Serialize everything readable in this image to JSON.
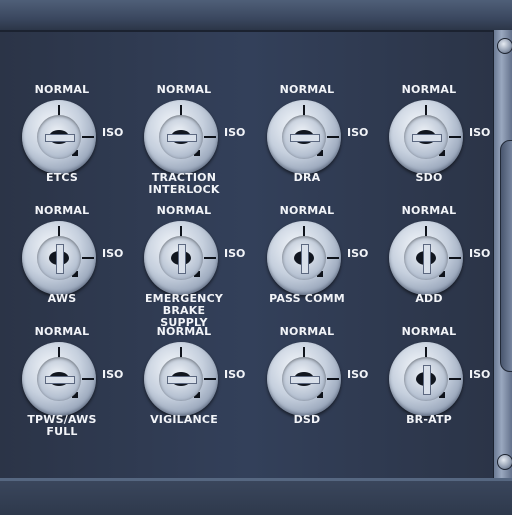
{
  "switches": [
    {
      "normal_label": "NORMAL",
      "iso_label": "ISO",
      "name": "ETCS"
    },
    {
      "normal_label": "NORMAL",
      "iso_label": "ISO",
      "name": "TRACTION\nINTERLOCK"
    },
    {
      "normal_label": "NORMAL",
      "iso_label": "ISO",
      "name": "DRA"
    },
    {
      "normal_label": "NORMAL",
      "iso_label": "ISO",
      "name": "SDO"
    },
    {
      "normal_label": "NORMAL",
      "iso_label": "ISO",
      "name": "AWS"
    },
    {
      "normal_label": "NORMAL",
      "iso_label": "ISO",
      "name": "EMERGENCY BRAKE\nSUPPLY"
    },
    {
      "normal_label": "NORMAL",
      "iso_label": "ISO",
      "name": "PASS COMM"
    },
    {
      "normal_label": "NORMAL",
      "iso_label": "ISO",
      "name": "ADD"
    },
    {
      "normal_label": "NORMAL",
      "iso_label": "ISO",
      "name": "TPWS/AWS\nFULL"
    },
    {
      "normal_label": "NORMAL",
      "iso_label": "ISO",
      "name": "VIGILANCE"
    },
    {
      "normal_label": "NORMAL",
      "iso_label": "ISO",
      "name": "DSD"
    },
    {
      "normal_label": "NORMAL",
      "iso_label": "ISO",
      "name": "BR-ATP"
    }
  ],
  "colors": {
    "panel": "#2a3344",
    "label": "#f2f4f8",
    "knob": "#c6d0de"
  }
}
